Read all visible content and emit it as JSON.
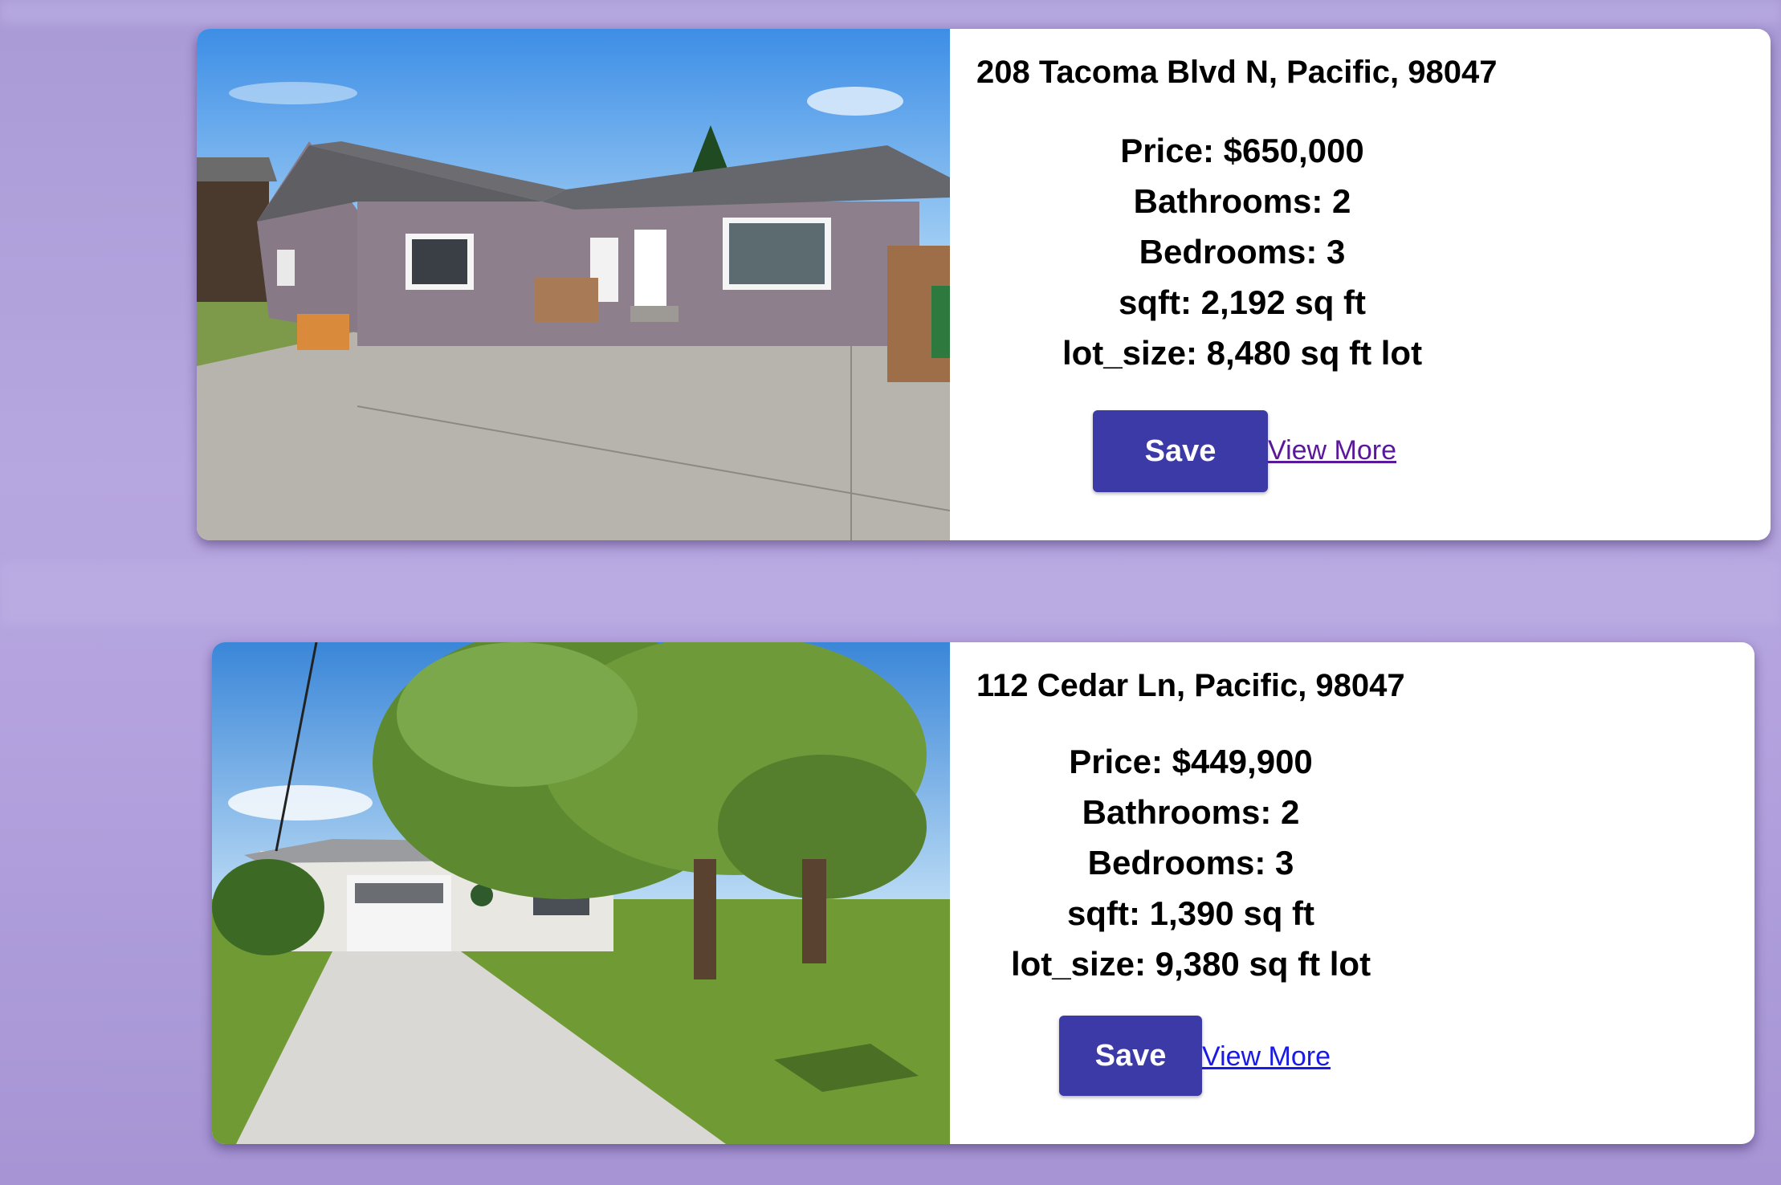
{
  "listings": [
    {
      "address": "208 Tacoma Blvd N, Pacific, 98047",
      "price": "Price: $650,000",
      "bathrooms": "Bathrooms: 2",
      "bedrooms": "Bedrooms: 3",
      "sqft": "sqft: 2,192 sq ft",
      "lot_size": "lot_size: 8,480 sq ft lot",
      "save_label": "Save",
      "view_more_label": "View More"
    },
    {
      "address": "112 Cedar Ln, Pacific, 98047",
      "price": "Price: $449,900",
      "bathrooms": "Bathrooms: 2",
      "bedrooms": "Bedrooms: 3",
      "sqft": "sqft: 1,390 sq ft",
      "lot_size": "lot_size: 9,380 sq ft lot",
      "save_label": "Save",
      "view_more_label": "View More"
    }
  ],
  "colors": {
    "page_background": "#b3a2de",
    "save_button": "#3b3aa6",
    "link_visited": "#5a189a",
    "link": "#1a1ae6"
  }
}
